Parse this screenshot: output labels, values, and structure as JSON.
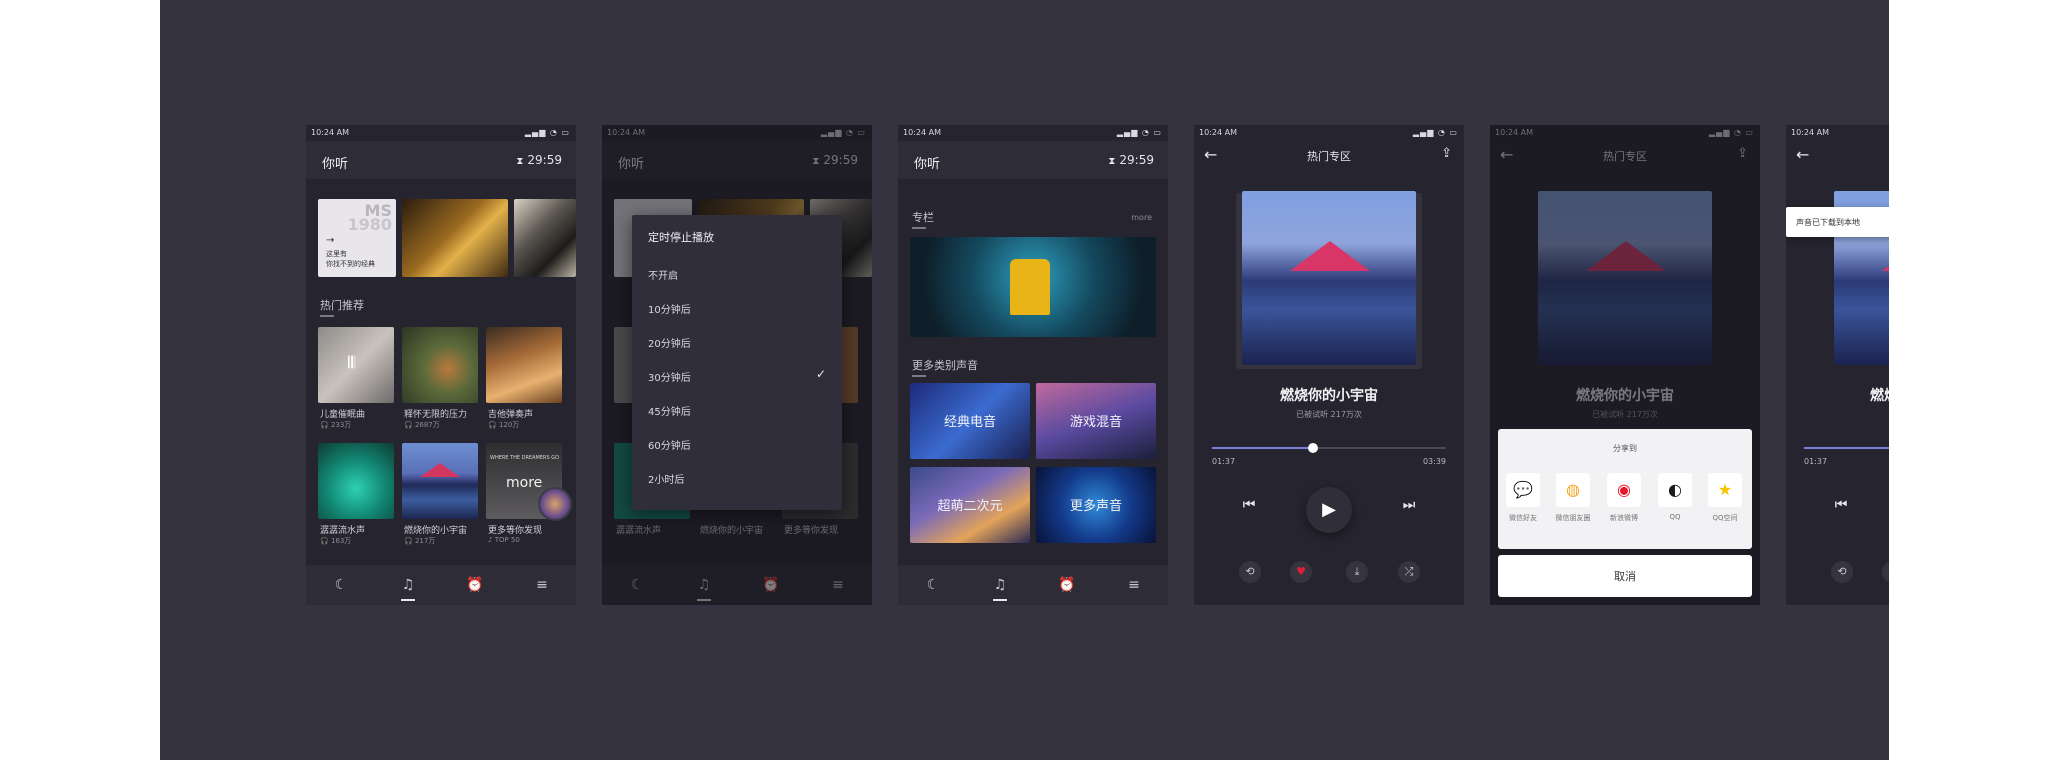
{
  "status": {
    "time": "10:24 AM",
    "icons": "▂▄▆ ◔ ▭"
  },
  "app": {
    "title": "你听",
    "timer": "29:59",
    "hourglass": "⧗"
  },
  "screen1": {
    "banners": [
      {
        "big": "MS",
        "num": "1980",
        "arrow": "→",
        "line1": "这里有",
        "line2": "你找不到的经典"
      },
      {},
      {}
    ],
    "section": "热门推荐",
    "tiles": [
      {
        "title": "儿童催眠曲",
        "count": "🎧 233万"
      },
      {
        "title": "释怀无限的压力",
        "count": "🎧 2687万"
      },
      {
        "title": "吉他弹奏声",
        "count": "🎧 120万"
      },
      {
        "title": "潺潺流水声",
        "count": "🎧 163万"
      },
      {
        "title": "燃烧你的小宇宙",
        "count": "🎧 217万"
      },
      {
        "title": "更多等你发现",
        "count": "♪ TOP 50",
        "overlay_top": "WHERE THE DREAMERS GO",
        "overlay": "more"
      }
    ]
  },
  "screen2": {
    "menu_title": "定时停止播放",
    "options": [
      "不开启",
      "10分钟后",
      "20分钟后",
      "30分钟后",
      "45分钟后",
      "60分钟后",
      "2小时后"
    ],
    "selected_check": "✓"
  },
  "screen3": {
    "section1": "专栏",
    "more": "more",
    "section2": "更多类别声音",
    "categories": [
      "经典电音",
      "游戏混音",
      "超萌二次元",
      "更多声音"
    ]
  },
  "player": {
    "header": "热门专区",
    "back": "←",
    "share_icon": "⇪",
    "song": "燃烧你的小宇宙",
    "sub": "已被试听  217万次",
    "elapsed": "01:37",
    "duration": "03:39",
    "progress": 0.43,
    "prev": "⏮",
    "play": "▶",
    "next": "⏭",
    "tools": [
      "⟲",
      "♥",
      "⤓",
      "⤮"
    ]
  },
  "share": {
    "title": "分享到",
    "targets": [
      {
        "label": "微信好友",
        "icon": "💬",
        "color": "#2dc100"
      },
      {
        "label": "微信朋友圈",
        "icon": "◍",
        "color": "#f5a623"
      },
      {
        "label": "新浪微博",
        "icon": "◉",
        "color": "#e6162d"
      },
      {
        "label": "QQ",
        "icon": "◐",
        "color": "#1a1a1a"
      },
      {
        "label": "QQ空间",
        "icon": "★",
        "color": "#f7c600"
      }
    ],
    "cancel": "取消"
  },
  "screen6": {
    "toast": "声音已下载到本地"
  },
  "colors": {
    "board": "#35333f",
    "phone": "#26252f",
    "accent": "#7b7fd6",
    "heart": "#e0203a"
  }
}
